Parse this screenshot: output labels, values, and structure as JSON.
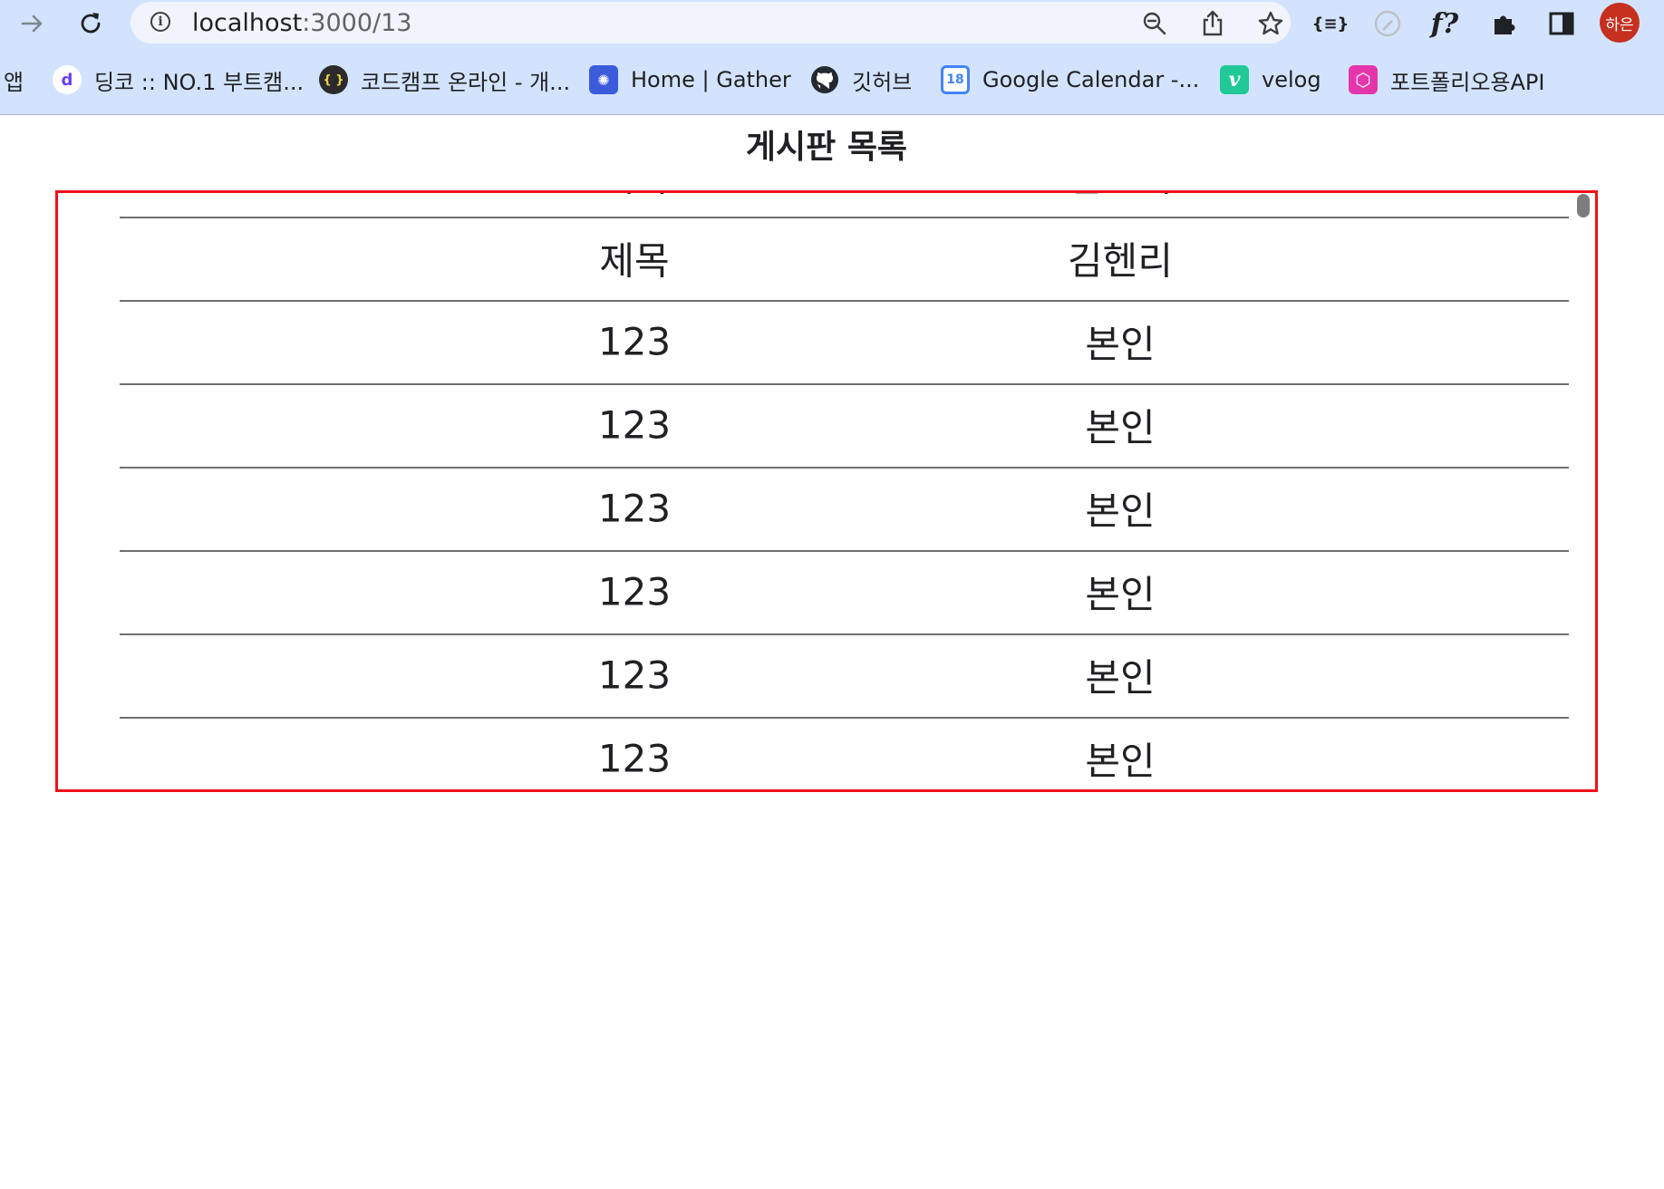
{
  "browser": {
    "url_host": "localhost",
    "url_path": ":3000/13",
    "profile_label": "하은",
    "extension_label_function": "f?",
    "extension_label_json": "{≡}"
  },
  "bookmarks": [
    {
      "label": "앱"
    },
    {
      "label": "딩코 :: NO.1 부트캠...",
      "icon": "dingco-icon",
      "icon_text": "d",
      "color": "#ffffff"
    },
    {
      "label": "코드캠프 온라인 - 개...",
      "icon": "codecamp-icon",
      "icon_text": "{ }",
      "color": "#333333"
    },
    {
      "label": "Home | Gather",
      "icon": "gather-icon",
      "icon_text": "✺",
      "color": "#3b5bdb"
    },
    {
      "label": "깃허브",
      "icon": "github-icon",
      "icon_text": "●",
      "color": "#24292f"
    },
    {
      "label": "Google Calendar -...",
      "icon": "google-calendar-icon",
      "icon_text": "18",
      "color": "#4285f4"
    },
    {
      "label": "velog",
      "icon": "velog-icon",
      "icon_text": "v",
      "color": "#20c997"
    },
    {
      "label": "포트폴리오용API",
      "icon": "graphql-icon",
      "icon_text": "⬡",
      "color": "#e535ab"
    }
  ],
  "page": {
    "title": "게시판 목록"
  },
  "board": {
    "header": {
      "col1": "제목",
      "col2": "김헨리"
    },
    "rows": [
      {
        "col1": "123",
        "col2": "본인"
      },
      {
        "col1": "123",
        "col2": "본인"
      },
      {
        "col1": "123",
        "col2": "본인"
      },
      {
        "col1": "123",
        "col2": "본인"
      },
      {
        "col1": "123",
        "col2": "본인"
      },
      {
        "col1": "123",
        "col2": "본인"
      }
    ]
  }
}
